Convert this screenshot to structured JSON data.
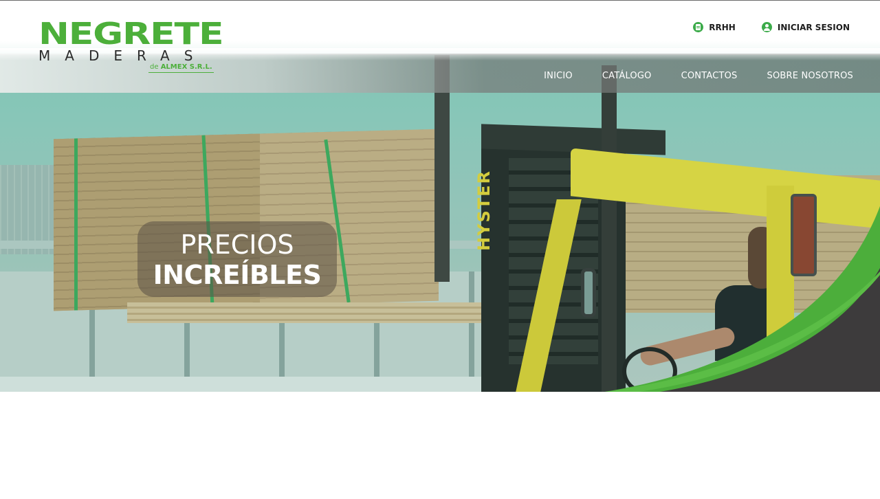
{
  "brand": {
    "name": "NEGRETE",
    "sub": "MADERAS",
    "tag_prefix": "de",
    "tag_company": "ALMEX S.R.L."
  },
  "top_links": {
    "rrhh": "RRHH",
    "login": "INICIAR SESION"
  },
  "nav": {
    "items": [
      {
        "label": "INICIO"
      },
      {
        "label": "CATÁLOGO"
      },
      {
        "label": "CONTACTOS"
      },
      {
        "label": "SOBRE NOSOTROS"
      }
    ]
  },
  "hero": {
    "headline_line1": "PRECIOS",
    "headline_line2": "INCREÍBLES",
    "forklift_brand": "HYSTER"
  },
  "colors": {
    "brand_green": "#4caf3a",
    "dark_gray": "#3d3b3c",
    "forklift_yellow": "#e8da3a"
  }
}
